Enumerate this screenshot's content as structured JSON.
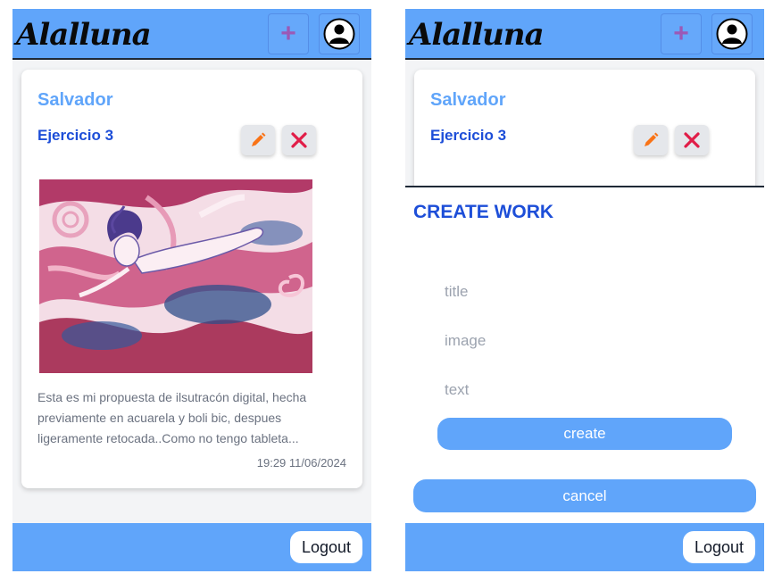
{
  "app": {
    "logo_text": "Alalluna"
  },
  "header": {
    "add_icon": "plus-icon",
    "user_icon": "user-avatar-icon"
  },
  "post": {
    "author": "Salvador",
    "title": "Ejercicio 3",
    "edit_icon": "pencil-icon",
    "delete_icon": "close-x-icon",
    "image_subject": "watercolor illustration of a figure swimming among pink tentacles",
    "description_lines": [
      "Esta es mi propuesta de ilsutracón digital, hecha",
      "previamente en acuarela y boli bic, despues",
      "ligeramente retocada..Como no tengo tableta..."
    ],
    "date": "19:29 11/06/2024"
  },
  "footer": {
    "logout_label": "Logout"
  },
  "create_form": {
    "heading": "CREATE WORK",
    "title_placeholder": "title",
    "image_placeholder": "image",
    "text_placeholder": "text",
    "create_label": "create",
    "cancel_label": "cancel"
  },
  "colors": {
    "header_bg": "#60a5fa",
    "author": "#60a5fa",
    "title": "#1d4ed8",
    "plus": "#9b59b6",
    "edit": "#f97316",
    "delete": "#e11d48"
  }
}
